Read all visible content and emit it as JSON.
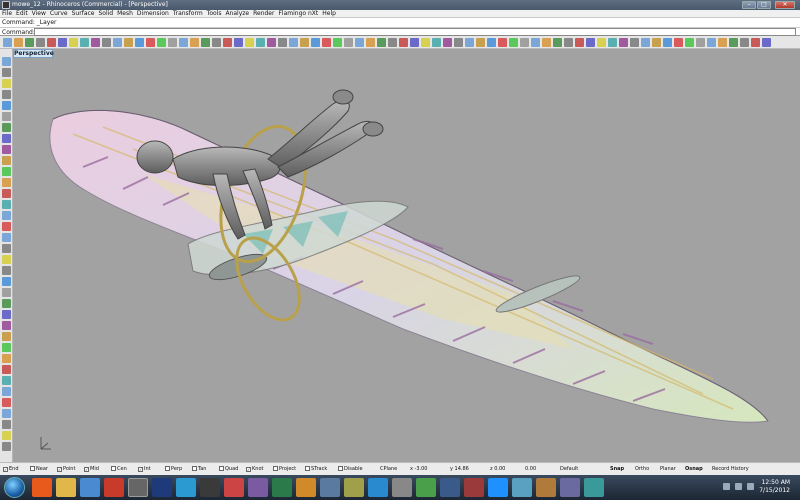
{
  "window": {
    "title": "mowe_12 - Rhinoceros (Commercial) - [Perspective]",
    "min_glyph": "–",
    "max_glyph": "□",
    "close_glyph": "✕"
  },
  "menu": [
    "File",
    "Edit",
    "View",
    "Curve",
    "Surface",
    "Solid",
    "Mesh",
    "Dimension",
    "Transform",
    "Tools",
    "Analyze",
    "Render",
    "Flamingo nXt",
    "Help"
  ],
  "command": {
    "history": "Command: _Layer",
    "label": "Command:",
    "value": ""
  },
  "viewport": {
    "tab_label": "Perspective"
  },
  "status": {
    "osnaps": [
      {
        "label": "End",
        "checked": true
      },
      {
        "label": "Near",
        "checked": false
      },
      {
        "label": "Point",
        "checked": true
      },
      {
        "label": "Mid",
        "checked": true
      },
      {
        "label": "Cen",
        "checked": false
      },
      {
        "label": "Int",
        "checked": true
      },
      {
        "label": "Perp",
        "checked": false
      },
      {
        "label": "Tan",
        "checked": false
      },
      {
        "label": "Quad",
        "checked": false
      },
      {
        "label": "Knot",
        "checked": true
      },
      {
        "label": "Project",
        "checked": false
      },
      {
        "label": "STrack",
        "checked": false
      },
      {
        "label": "Disable",
        "checked": false
      }
    ],
    "cplane": "CPlane",
    "x": "x -3.00",
    "y": "y 14.86",
    "z": "z 0.00",
    "dist": "0.00",
    "layer": "Default",
    "toggles": [
      "Snap",
      "Ortho",
      "Planar",
      "Osnap",
      "Record History"
    ]
  },
  "taskbar": {
    "time": "12:50 AM",
    "date": "7/15/2012"
  },
  "colors": {
    "viewport_bg": "#a2a2a2",
    "wing_pink": "#e9c9df",
    "wing_green": "#d8e8b8",
    "wing_purple": "#9a6ea0",
    "ring_gold": "#b9a04a",
    "figure_gray": "#7d7d7d"
  }
}
